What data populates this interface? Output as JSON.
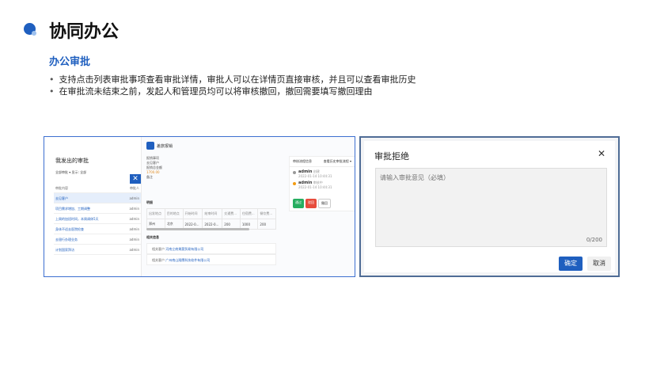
{
  "page": {
    "title": "协同办公",
    "subtitle": "办公审批",
    "bullets": [
      "支持点击列表审批事项查看审批详情，审批人可以在详情页直接审核，并且可以查看审批历史",
      "在审批流未结束之前，发起人和管理员均可以将审核撤回，撤回需要填写撤回理由"
    ]
  },
  "left_panel": {
    "title": "我发出的审批",
    "filter": "全部审批  ▾   显示:  全部",
    "list": [
      {
        "title": "审批内容",
        "approver": "审批人"
      },
      {
        "title": "去见客户",
        "approver": "admin"
      },
      {
        "title": "项目需求增加、工期调整",
        "approver": "admin"
      },
      {
        "title": "上周的加班时间，本周调休5天",
        "approver": "admin"
      },
      {
        "title": "身体不适去医院检查",
        "approver": "admin"
      },
      {
        "title": "去银行办理业务",
        "approver": "admin"
      },
      {
        "title": "计划国家拜访",
        "approver": "admin"
      }
    ]
  },
  "detail": {
    "header": "差旅报销",
    "info": [
      "报销事项",
      "去见客户",
      "报销总金额",
      "1700.00",
      "备注"
    ],
    "detail_label": "明细",
    "table": [
      [
        "出发地点",
        "目的地点",
        "开始时间",
        "结束时间",
        "交通费...",
        "住宿费...",
        "餐饮费..."
      ],
      [
        "郑州",
        "北京",
        "2022-0...",
        "2022-0...",
        "200",
        "1000",
        "200"
      ]
    ],
    "attach_label": "相关信息",
    "attachments": [
      {
        "label": "相关客户",
        "value": "河南立商果蔬贸易有限公司"
      },
      {
        "label": "相关客户",
        "value": "广州南山翔鹰科技软件有限公司"
      }
    ],
    "history": {
      "title": "审核流程信息",
      "link": "查看历史审批流程  ▾",
      "items": [
        {
          "name": "admin",
          "action": "创建",
          "time": "2022-01-14 10:44:31"
        },
        {
          "name": "admin",
          "action": "审核中",
          "time": "2022-01-14 10:44:31"
        }
      ],
      "buttons": [
        "通过",
        "驳回",
        "撤回"
      ]
    }
  },
  "dialog": {
    "title": "审批拒绝",
    "placeholder": "请输入审批意见（必填）",
    "counter": "0/200",
    "ok": "确定",
    "cancel": "取消"
  }
}
